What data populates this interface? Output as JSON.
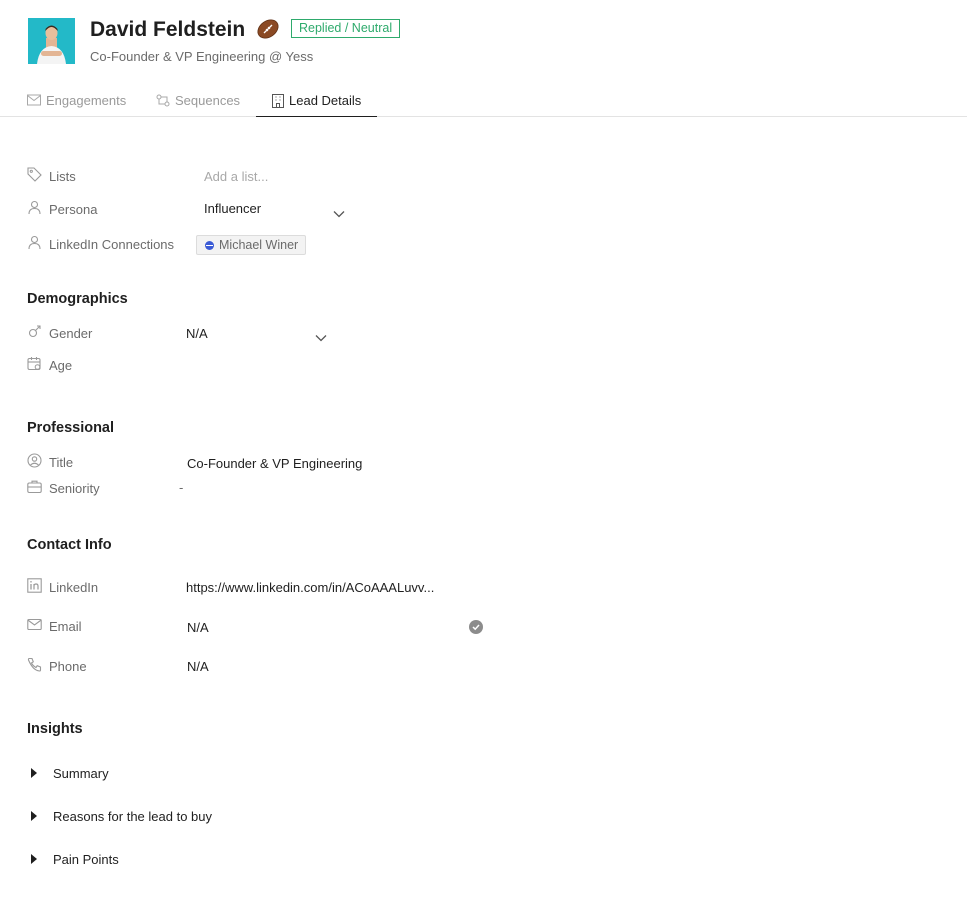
{
  "header": {
    "name": "David Feldstein",
    "emoji_icon": "football-icon",
    "status_badge": "Replied / Neutral",
    "subtitle": "Co-Founder & VP Engineering @ Yess",
    "accent_color": "#2eaa6c",
    "avatar_bg": "#23b9c8"
  },
  "tabs": [
    {
      "label": "Engagements",
      "icon": "mail-icon",
      "active": false
    },
    {
      "label": "Sequences",
      "icon": "sequence-icon",
      "active": false
    },
    {
      "label": "Lead Details",
      "icon": "building-icon",
      "active": true
    }
  ],
  "fields": {
    "lists": {
      "label": "Lists",
      "placeholder": "Add a list..."
    },
    "persona": {
      "label": "Persona",
      "value": "Influencer"
    },
    "linkedin_connections": {
      "label": "LinkedIn Connections",
      "chip": "Michael Winer"
    }
  },
  "demographics": {
    "title": "Demographics",
    "gender": {
      "label": "Gender",
      "value": "N/A"
    },
    "age": {
      "label": "Age",
      "value": ""
    }
  },
  "professional": {
    "title": "Professional",
    "job_title": {
      "label": "Title",
      "value": "Co-Founder & VP Engineering"
    },
    "seniority": {
      "label": "Seniority",
      "value": "-"
    }
  },
  "contact": {
    "title": "Contact Info",
    "linkedin": {
      "label": "LinkedIn",
      "value": "https://www.linkedin.com/in/ACoAAALuvv..."
    },
    "email": {
      "label": "Email",
      "value": "N/A"
    },
    "phone": {
      "label": "Phone",
      "value": "N/A"
    }
  },
  "insights": {
    "title": "Insights",
    "items": [
      "Summary",
      "Reasons for the lead to buy",
      "Pain Points"
    ]
  }
}
